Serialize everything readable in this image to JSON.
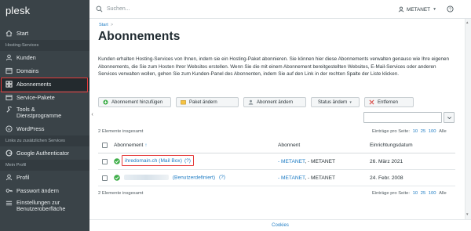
{
  "sidebar": {
    "logo": "plesk",
    "logo_sub": "",
    "items": [
      {
        "label": "Start",
        "icon": "home-icon"
      },
      {
        "section": "Hosting-Services"
      },
      {
        "label": "Kunden",
        "icon": "user-icon"
      },
      {
        "label": "Domains",
        "icon": "globe-icon"
      },
      {
        "label": "Abonnements",
        "icon": "grid-icon",
        "active": true
      },
      {
        "label": "Service-Pakete",
        "icon": "package-icon"
      },
      {
        "label": "Tools & Dienstprogramme",
        "icon": "tools-icon"
      },
      {
        "label": "WordPress",
        "icon": "wordpress-icon"
      },
      {
        "section": "Links zu zusätzlichen Services"
      },
      {
        "label": "Google Authenticator",
        "icon": "google-icon"
      },
      {
        "section": "Mein Profil"
      },
      {
        "label": "Profil",
        "icon": "user-icon"
      },
      {
        "label": "Passwort ändern",
        "icon": "key-icon"
      },
      {
        "label": "Einstellungen zur Benutzeroberfläche",
        "icon": "settings-icon"
      }
    ]
  },
  "topbar": {
    "search_placeholder": "Suchen...",
    "user": "METANET",
    "help": "?"
  },
  "breadcrumb": {
    "item": "Start",
    "sep": ">"
  },
  "page_title": "Abonnements",
  "intro": "Kunden erhalten Hosting-Services von Ihnen, indem sie ein Hosting-Paket abonnieren. Sie können hier diese Abonnements verwalten genauso wie Ihre eigenen Abonnements, die Sie zum Hosten Ihrer Websites erstellen. Wenn Sie die mit einem Abonnement bereitgestellten Websites, E-Mail-Services oder anderen Services verwalten wollen, gehen Sie zum Kunden-Panel des Abonnenten, indem Sie auf den Link in der rechten Spalte der Liste klicken.",
  "toolbar": {
    "add": "Abonnement hinzufügen",
    "change_plan": "Paket ändern",
    "change_subscriber": "Abonnent ändern",
    "change_status": "Status ändern",
    "remove": "Entfernen"
  },
  "list": {
    "total": "2 Elemente insgesamt",
    "per_page_label": "Einträge pro Seite:",
    "per_page_options": [
      "10",
      "25",
      "100",
      "Alle"
    ],
    "per_page_selected": "Alle",
    "headers": {
      "subscription": "Abonnement",
      "sort": "↑",
      "subscriber": "Abonnent",
      "date": "Einrichtungsdatum"
    },
    "rows": [
      {
        "domain": "ihredomain.ch (Mail Box)",
        "help": "(?)",
        "subscriber_link": "- METANET",
        "subscriber_rest": ", - METANET",
        "date": "26. März 2021"
      },
      {
        "domain": "(Benutzerdefiniert)",
        "help": "(?)",
        "subscriber_link": "- METANET",
        "subscriber_rest": ", - METANET",
        "date": "24. Febr. 2008"
      }
    ]
  },
  "footer": {
    "cookies": "Cookies"
  },
  "colors": {
    "sidebar": "#3a4348",
    "accent": "#1e7cc4",
    "highlight": "#e53a3a",
    "ok": "#3fae49"
  }
}
